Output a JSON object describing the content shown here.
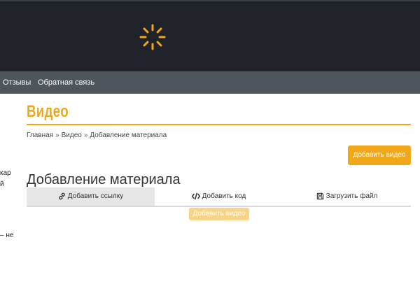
{
  "nav": {
    "items": [
      {
        "label": "Отзывы"
      },
      {
        "label": "Обратная связь"
      }
    ]
  },
  "page": {
    "title": "Видео",
    "breadcrumb": {
      "home": "Главная",
      "section": "Видео",
      "current": "Добавление материала",
      "separator": "»"
    },
    "add_button_label": "Добавить видео"
  },
  "form": {
    "heading": "Добавление материала",
    "tabs": [
      {
        "label": "Добавить ссылку",
        "icon": "link-icon",
        "active": true
      },
      {
        "label": "Добавить код",
        "icon": "code-icon",
        "active": false
      },
      {
        "label": "Загрузить файл",
        "icon": "save-icon",
        "active": false
      }
    ],
    "submit_label": "Добавить видео"
  },
  "sidebar_fragments": {
    "line1": "кар",
    "line2": "й",
    "line3": "– не"
  },
  "colors": {
    "accent": "#f0a81a",
    "header_bg": "#1f2228",
    "nav_bg": "#4f555d"
  }
}
